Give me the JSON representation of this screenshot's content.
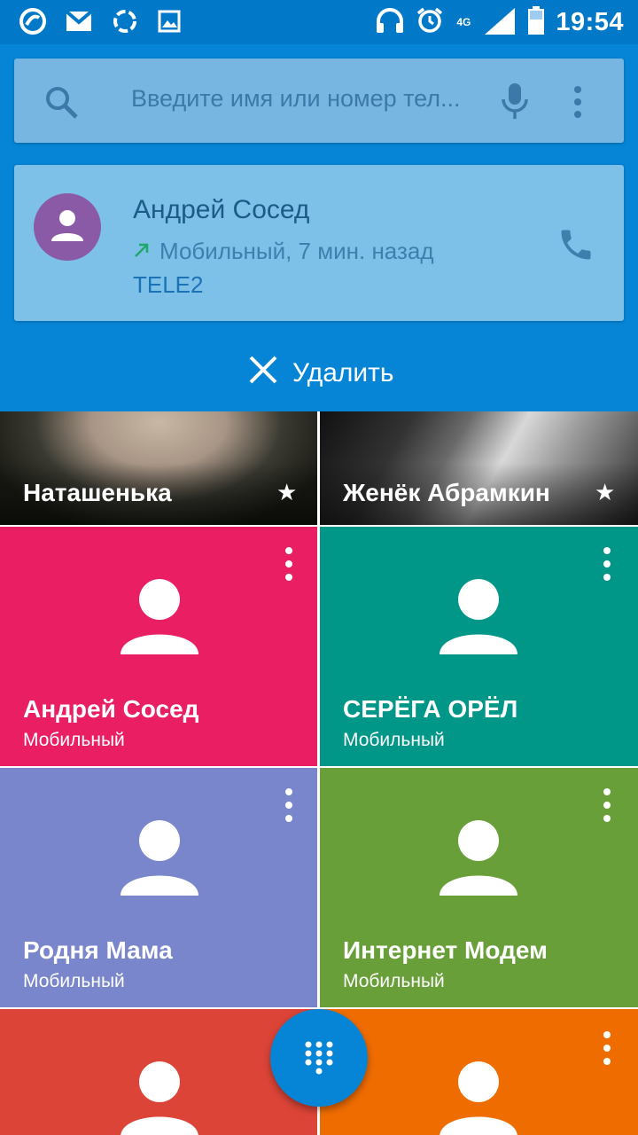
{
  "status_bar": {
    "time": "19:54",
    "network": "4G",
    "left_icons": [
      "app-notification-icon",
      "gmail-icon",
      "sync-icon",
      "gallery-icon"
    ],
    "right_icons": [
      "headphones-icon",
      "alarm-icon",
      "network-4g-icon",
      "signal-icon",
      "battery-icon"
    ]
  },
  "search": {
    "placeholder": "Введите имя или номер тел..."
  },
  "recent_call": {
    "name": "Андрей Сосед",
    "detail": "Мобильный, 7 мин. назад",
    "carrier": "TELE2",
    "avatar_color": "#8a5aa6"
  },
  "remove_label": "Удалить",
  "favorites": [
    {
      "name": "Наташенька",
      "starred": true,
      "type": "photo"
    },
    {
      "name": "Женёк Абрамкин",
      "starred": true,
      "type": "photo"
    },
    {
      "name": "Андрей Сосед",
      "label": "Мобильный",
      "color": "#e91e63"
    },
    {
      "name": "СЕРЁГА ОРЁЛ",
      "label": "Мобильный",
      "color": "#009688"
    },
    {
      "name": "Родня Мама",
      "label": "Мобильный",
      "color": "#7986cb"
    },
    {
      "name": "Интернет Модем",
      "label": "Мобильный",
      "color": "#689f38"
    },
    {
      "name": "",
      "label": "",
      "color": "#db4437"
    },
    {
      "name": "",
      "label": "",
      "color": "#ef6c00"
    }
  ],
  "colors": {
    "header": "#0685d6",
    "status_bar": "#0278c8"
  }
}
